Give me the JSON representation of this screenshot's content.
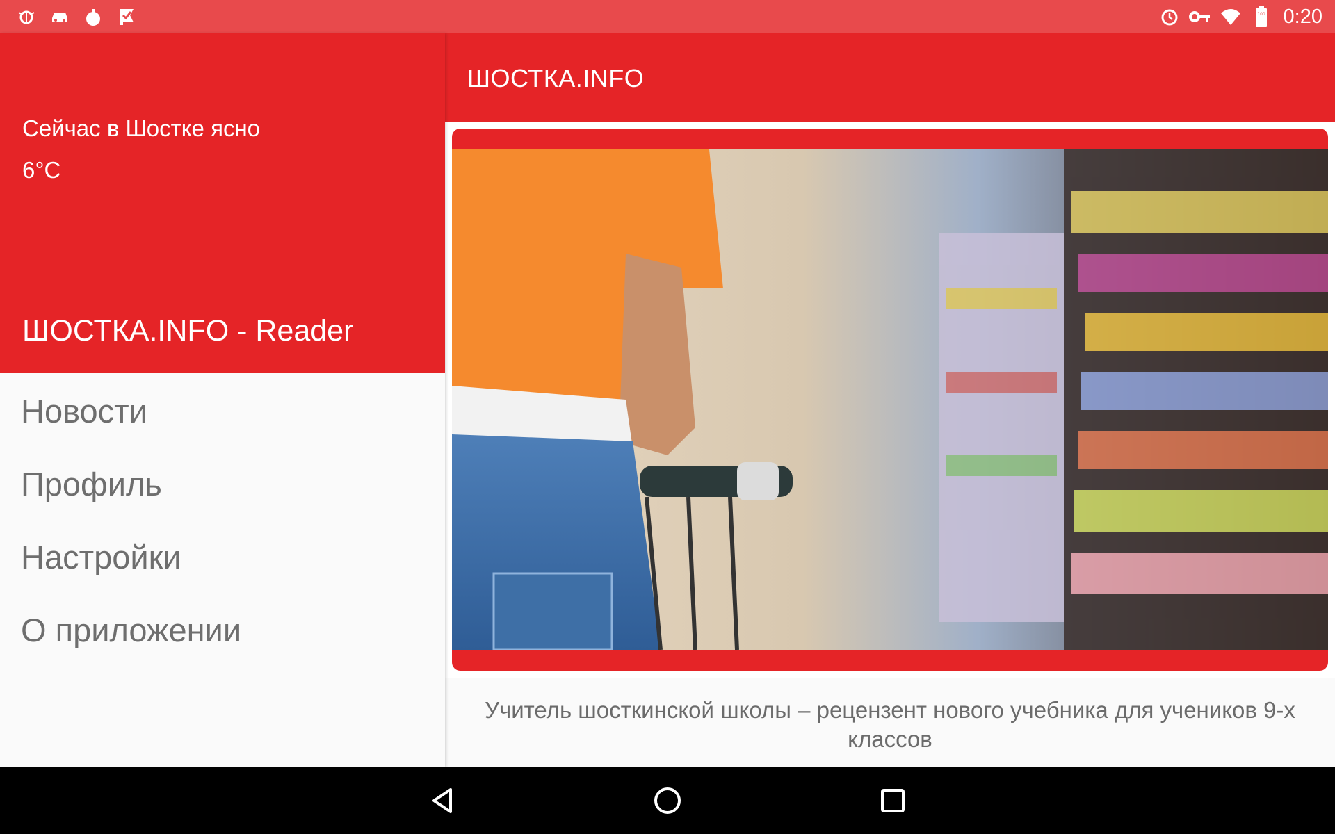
{
  "status_bar": {
    "left_icons": [
      "bug-icon",
      "car-icon",
      "bomb-icon",
      "check-flag-icon"
    ],
    "right_icons": [
      "alarm-icon",
      "key-icon",
      "wifi-icon",
      "battery-icon"
    ],
    "battery_text": "100",
    "time": "0:20",
    "color": "#e84a4c"
  },
  "toolbar": {
    "title": "ШОСТКА.INFO",
    "color": "#e52427"
  },
  "drawer": {
    "weather": {
      "text": "Сейчас в Шостке ясно",
      "temperature": "6°C"
    },
    "app_name": "ШОСТКА.INFO - Reader",
    "menu": [
      {
        "label": "Новости"
      },
      {
        "label": "Профиль"
      },
      {
        "label": "Настройки"
      },
      {
        "label": "О приложении"
      }
    ]
  },
  "article": {
    "image_alt_icon": "supermarket-photo",
    "headline": "Учитель шосткинской школы – рецензент нового учебника для учеников 9-х классов"
  },
  "nav_bar": {
    "buttons": [
      "back-icon",
      "home-icon",
      "recents-icon"
    ]
  },
  "colors": {
    "accent": "#e52427",
    "menu_text": "#6e6e6e",
    "headline_text": "#6b6b6b"
  }
}
